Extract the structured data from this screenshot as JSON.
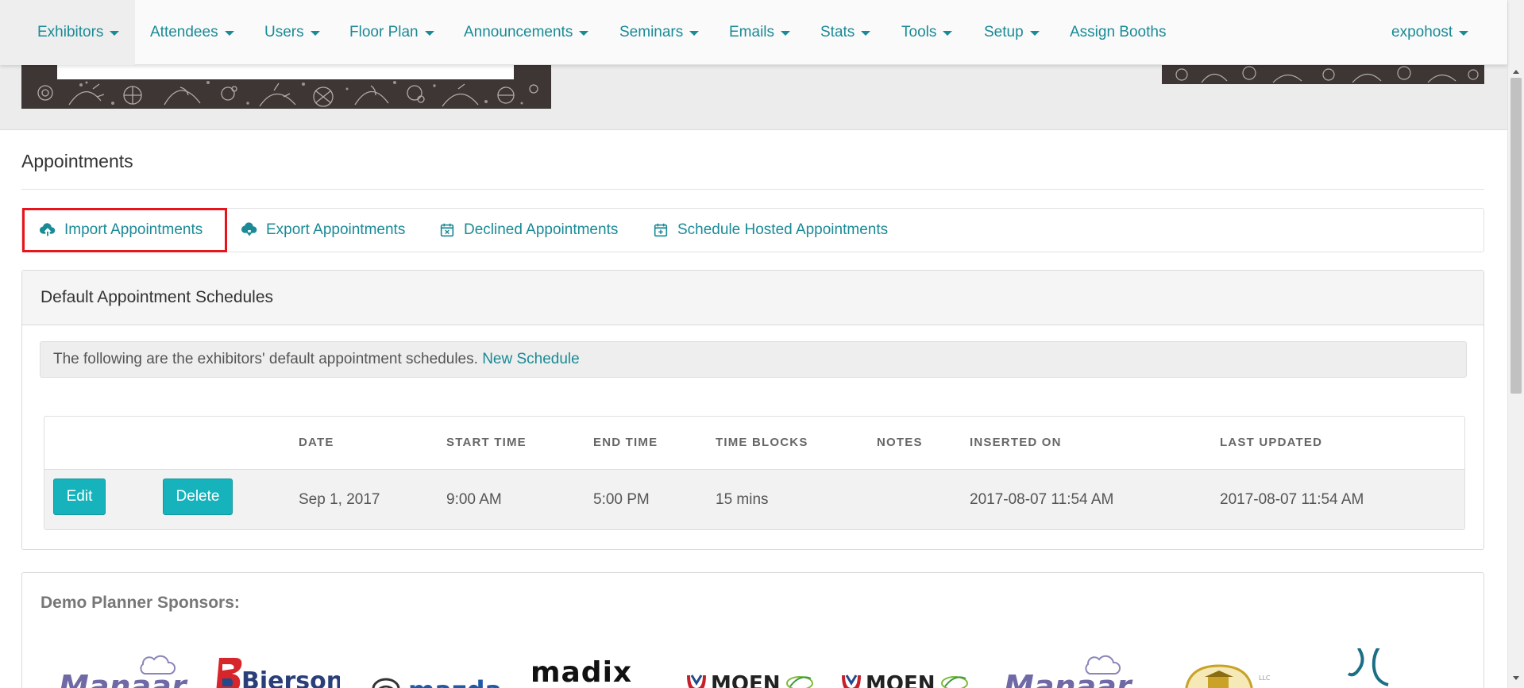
{
  "nav": {
    "items": [
      {
        "label": "Exhibitors",
        "dropdown": true
      },
      {
        "label": "Attendees",
        "dropdown": true
      },
      {
        "label": "Users",
        "dropdown": true
      },
      {
        "label": "Floor Plan",
        "dropdown": true
      },
      {
        "label": "Announcements",
        "dropdown": true
      },
      {
        "label": "Seminars",
        "dropdown": true
      },
      {
        "label": "Emails",
        "dropdown": true
      },
      {
        "label": "Stats",
        "dropdown": true
      },
      {
        "label": "Tools",
        "dropdown": true
      },
      {
        "label": "Setup",
        "dropdown": true
      },
      {
        "label": "Assign Booths",
        "dropdown": false
      }
    ],
    "user": "expohost"
  },
  "page": {
    "title": "Appointments"
  },
  "actions": {
    "import": "Import Appointments",
    "export": "Export Appointments",
    "declined": "Declined Appointments",
    "schedule_hosted": "Schedule Hosted Appointments"
  },
  "panel": {
    "title": "Default Appointment Schedules",
    "info_text": "The following are the exhibitors' default appointment schedules.",
    "info_link": "New Schedule"
  },
  "table": {
    "headers": {
      "date": "DATE",
      "start_time": "START TIME",
      "end_time": "END TIME",
      "time_blocks": "TIME BLOCKS",
      "notes": "NOTES",
      "inserted_on": "INSERTED ON",
      "last_updated": "LAST UPDATED"
    },
    "rows": [
      {
        "edit": "Edit",
        "delete": "Delete",
        "date": "Sep 1, 2017",
        "start_time": "9:00 AM",
        "end_time": "5:00 PM",
        "time_blocks": "15 mins",
        "notes": "",
        "inserted_on": "2017-08-07 11:54 AM",
        "last_updated": "2017-08-07 11:54 AM"
      }
    ]
  },
  "sponsors": {
    "title": "Demo Planner Sponsors:",
    "logos": [
      "Manaar",
      "Bierson",
      "mazda",
      "madix",
      "MOEN",
      "MOEN",
      "Manaar",
      "",
      ""
    ]
  },
  "colors": {
    "link": "#1a8a96",
    "button": "#17b3bc",
    "highlight": "#e8141c"
  }
}
